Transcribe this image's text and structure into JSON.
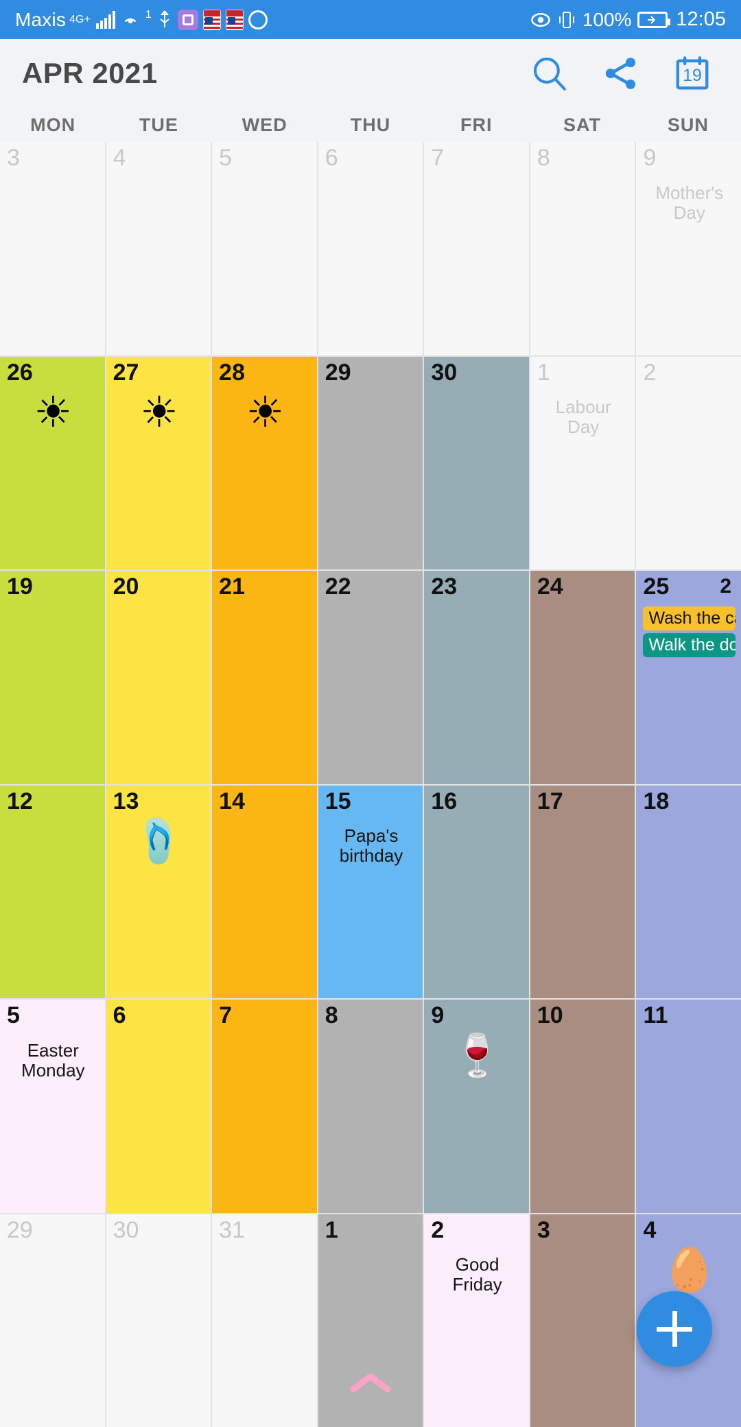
{
  "statusbar": {
    "carrier": "Maxis",
    "network": "4G+",
    "hotspot_superscript": "1",
    "battery_percent": "100%",
    "clock": "12:05",
    "icons": [
      "signal-bars-icon",
      "hotspot-icon",
      "usb-icon",
      "sim-card-icon",
      "flag-us-icon",
      "flag-my-icon",
      "whatsapp-icon",
      "eye-icon",
      "vibrate-icon",
      "battery-charging-icon"
    ],
    "accent": "#2f8ce0"
  },
  "appbar": {
    "title": "APR 2021",
    "search_label": "search-icon",
    "share_label": "share-icon",
    "today_label": "today-icon",
    "today_day": "19",
    "accent": "#2f8ce0"
  },
  "weekdays": [
    "MON",
    "TUE",
    "WED",
    "THU",
    "FRI",
    "SAT",
    "SUN"
  ],
  "colors": {
    "green": "#c8de3e",
    "yellow": "#fde445",
    "orange": "#fcb614",
    "gray": "#b2b2b2",
    "bluegray": "#97adb6",
    "brown": "#a98d80",
    "periwinkle": "#9ba7dd",
    "lightblue": "#66b8f3",
    "pink": "#fdeefb",
    "empty": "#f7f7f8",
    "chip_wash": "#f7c12b",
    "chip_walk": "#0c9784",
    "chevron_pink": "#fba3c4"
  },
  "weeks": [
    [
      {
        "day": "29",
        "other": true,
        "bg": "empty"
      },
      {
        "day": "30",
        "other": true,
        "bg": "empty"
      },
      {
        "day": "31",
        "other": true,
        "bg": "empty"
      },
      {
        "day": "1",
        "bg": "gray"
      },
      {
        "day": "2",
        "bg": "pink",
        "holiday": "Good Friday"
      },
      {
        "day": "3",
        "bg": "brown"
      },
      {
        "day": "4",
        "bg": "periwinkle",
        "emoji": "🥚",
        "emoji_name": "easter-egg-emoji"
      }
    ],
    [
      {
        "day": "5",
        "bg": "pink",
        "holiday": "Easter Monday"
      },
      {
        "day": "6",
        "bg": "yellow"
      },
      {
        "day": "7",
        "bg": "orange"
      },
      {
        "day": "8",
        "bg": "gray"
      },
      {
        "day": "9",
        "bg": "bluegray",
        "emoji": "🍷",
        "emoji_name": "wine-cheese-emoji"
      },
      {
        "day": "10",
        "bg": "brown"
      },
      {
        "day": "11",
        "bg": "periwinkle"
      }
    ],
    [
      {
        "day": "12",
        "bg": "green"
      },
      {
        "day": "13",
        "bg": "yellow",
        "emoji": "🩴",
        "emoji_name": "flip-flops-emoji"
      },
      {
        "day": "14",
        "bg": "orange"
      },
      {
        "day": "15",
        "bg": "lightblue",
        "holiday": "Papa's birthday"
      },
      {
        "day": "16",
        "bg": "bluegray"
      },
      {
        "day": "17",
        "bg": "brown"
      },
      {
        "day": "18",
        "bg": "periwinkle"
      }
    ],
    [
      {
        "day": "19",
        "bg": "green"
      },
      {
        "day": "20",
        "bg": "yellow"
      },
      {
        "day": "21",
        "bg": "orange"
      },
      {
        "day": "22",
        "bg": "gray"
      },
      {
        "day": "23",
        "bg": "bluegray"
      },
      {
        "day": "24",
        "bg": "brown"
      },
      {
        "day": "25",
        "bg": "periwinkle",
        "badge": "2",
        "events": [
          {
            "label": "Wash the car",
            "color": "chip_wash",
            "text": "#111111"
          },
          {
            "label": "Walk the dog",
            "color": "chip_walk",
            "text": "#ffffff"
          }
        ]
      }
    ],
    [
      {
        "day": "26",
        "bg": "green",
        "emoji": "☀",
        "emoji_name": "sun-emoji"
      },
      {
        "day": "27",
        "bg": "yellow",
        "emoji": "☀",
        "emoji_name": "sun-emoji"
      },
      {
        "day": "28",
        "bg": "orange",
        "emoji": "☀",
        "emoji_name": "sun-emoji"
      },
      {
        "day": "29",
        "bg": "gray"
      },
      {
        "day": "30",
        "bg": "bluegray"
      },
      {
        "day": "1",
        "other": true,
        "bg": "empty",
        "holiday": "Labour Day"
      },
      {
        "day": "2",
        "other": true,
        "bg": "empty"
      }
    ],
    [
      {
        "day": "3",
        "other": true,
        "bg": "empty"
      },
      {
        "day": "4",
        "other": true,
        "bg": "empty"
      },
      {
        "day": "5",
        "other": true,
        "bg": "empty"
      },
      {
        "day": "6",
        "other": true,
        "bg": "empty"
      },
      {
        "day": "7",
        "other": true,
        "bg": "empty"
      },
      {
        "day": "8",
        "other": true,
        "bg": "empty"
      },
      {
        "day": "9",
        "other": true,
        "bg": "empty",
        "holiday": "Mother's Day"
      }
    ]
  ],
  "fab": {
    "label": "add-event-button"
  },
  "chevron": {
    "label": "collapse-chevron"
  }
}
